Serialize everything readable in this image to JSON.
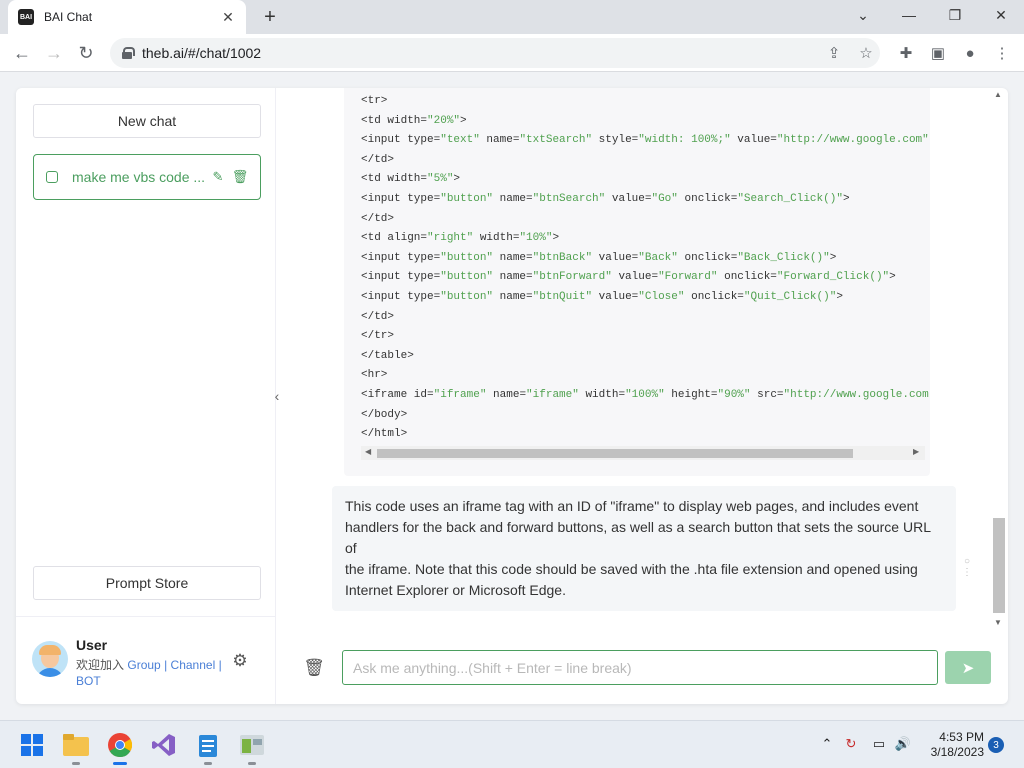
{
  "browser": {
    "tab_title": "BAI Chat",
    "favicon_text": "BAI",
    "url": "theb.ai/#/chat/1002"
  },
  "sidebar": {
    "new_chat_label": "New chat",
    "chat_items": [
      {
        "title": "make me vbs code ..."
      }
    ],
    "prompt_store_label": "Prompt Store",
    "user": {
      "name": "User",
      "welcome_prefix": "欢迎加入",
      "link_group": "Group",
      "separator": "|",
      "link_channel": "Channel",
      "link_bot": "BOT"
    }
  },
  "chat": {
    "code_lines": [
      "<tr>",
      "<td width=\"20%\">",
      "<input type=\"text\" name=\"txtSearch\" style=\"width: 100%;\" value=\"http://www.google.com\">",
      "</td>",
      "<td width=\"5%\">",
      "<input type=\"button\" name=\"btnSearch\" value=\"Go\" onclick=\"Search_Click()\">",
      "</td>",
      "<td align=\"right\" width=\"10%\">",
      "<input type=\"button\" name=\"btnBack\" value=\"Back\" onclick=\"Back_Click()\">",
      "<input type=\"button\" name=\"btnForward\" value=\"Forward\" onclick=\"Forward_Click()\">",
      "<input type=\"button\" name=\"btnQuit\" value=\"Close\" onclick=\"Quit_Click()\">",
      "</td>",
      "</tr>",
      "</table>",
      "<hr>",
      "<iframe id=\"iframe\" name=\"iframe\" width=\"100%\" height=\"90%\" src=\"http://www.google.com\"",
      "</body>",
      "</html>"
    ],
    "message_lines": [
      "This code uses an iframe tag with an ID of \"iframe\" to display web pages, and includes event",
      "handlers for the back and forward buttons, as well as a search button that sets the source URL of",
      "the iframe. Note that this code should be saved with the .hta file extension and opened using",
      "Internet Explorer or Microsoft Edge."
    ],
    "input_placeholder": "Ask me anything...(Shift + Enter = line break)",
    "input_value": ""
  },
  "taskbar": {
    "time": "4:53 PM",
    "date": "3/18/2023",
    "notification_count": "3"
  },
  "colors": {
    "accent": "#4b9e5f",
    "send_button": "#9cd3ae",
    "link": "#4a7fd6"
  }
}
